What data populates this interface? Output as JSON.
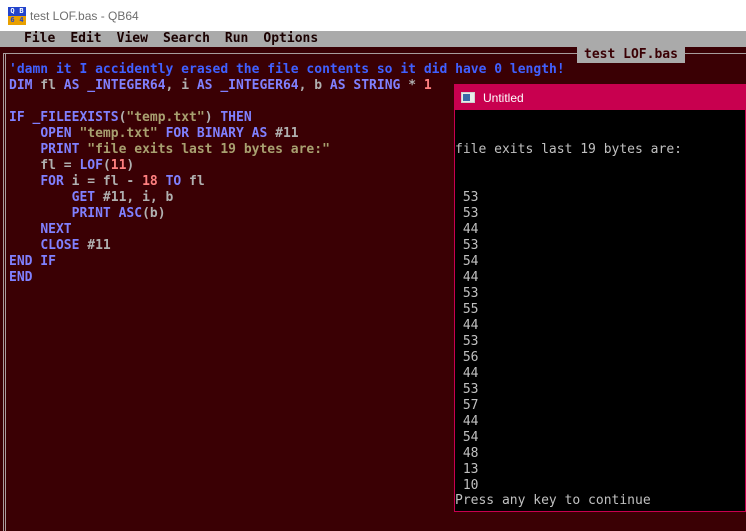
{
  "window": {
    "title": "test LOF.bas - QB64",
    "icon": "qb64-app-icon",
    "icon_text": [
      "Q",
      "B",
      "6",
      "4"
    ]
  },
  "menu": {
    "items": [
      "File",
      "Edit",
      "View",
      "Search",
      "Run",
      "Options"
    ]
  },
  "editor": {
    "file_tab": "test LOF.bas",
    "colors": {
      "background": "#3a0004",
      "keyword": "#8080ff",
      "comment": "#4060ff",
      "string": "#a8a070",
      "number": "#ff8080",
      "text": "#b0b0b0"
    },
    "lines": [
      [
        {
          "t": "cm",
          "v": "'damn it I accidently erased the file contents so it did have 0 length!"
        }
      ],
      [
        {
          "t": "kw",
          "v": "DIM"
        },
        {
          "t": "tx",
          "v": " fl "
        },
        {
          "t": "kw",
          "v": "AS _INTEGER64"
        },
        {
          "t": "tx",
          "v": ", i "
        },
        {
          "t": "kw",
          "v": "AS _INTEGER64"
        },
        {
          "t": "tx",
          "v": ", b "
        },
        {
          "t": "kw",
          "v": "AS STRING"
        },
        {
          "t": "tx",
          "v": " * "
        },
        {
          "t": "nm",
          "v": "1"
        }
      ],
      [],
      [
        {
          "t": "kw",
          "v": "IF _FILEEXISTS"
        },
        {
          "t": "tx",
          "v": "("
        },
        {
          "t": "st",
          "v": "\"temp.txt\""
        },
        {
          "t": "tx",
          "v": ") "
        },
        {
          "t": "kw",
          "v": "THEN"
        }
      ],
      [
        {
          "t": "tx",
          "v": "    "
        },
        {
          "t": "kw",
          "v": "OPEN"
        },
        {
          "t": "tx",
          "v": " "
        },
        {
          "t": "st",
          "v": "\"temp.txt\""
        },
        {
          "t": "tx",
          "v": " "
        },
        {
          "t": "kw",
          "v": "FOR BINARY AS"
        },
        {
          "t": "tx",
          "v": " #11"
        }
      ],
      [
        {
          "t": "tx",
          "v": "    "
        },
        {
          "t": "kw",
          "v": "PRINT"
        },
        {
          "t": "tx",
          "v": " "
        },
        {
          "t": "st",
          "v": "\"file exits last 19 bytes are:\""
        }
      ],
      [
        {
          "t": "tx",
          "v": "    fl = "
        },
        {
          "t": "kw",
          "v": "LOF"
        },
        {
          "t": "tx",
          "v": "("
        },
        {
          "t": "nm",
          "v": "11"
        },
        {
          "t": "tx",
          "v": ")"
        }
      ],
      [
        {
          "t": "tx",
          "v": "    "
        },
        {
          "t": "kw",
          "v": "FOR"
        },
        {
          "t": "tx",
          "v": " i = fl - "
        },
        {
          "t": "nm",
          "v": "18"
        },
        {
          "t": "tx",
          "v": " "
        },
        {
          "t": "kw",
          "v": "TO"
        },
        {
          "t": "tx",
          "v": " fl"
        }
      ],
      [
        {
          "t": "tx",
          "v": "        "
        },
        {
          "t": "kw",
          "v": "GET"
        },
        {
          "t": "tx",
          "v": " #11, i, b"
        }
      ],
      [
        {
          "t": "tx",
          "v": "        "
        },
        {
          "t": "kw",
          "v": "PRINT ASC"
        },
        {
          "t": "tx",
          "v": "(b)"
        }
      ],
      [
        {
          "t": "tx",
          "v": "    "
        },
        {
          "t": "kw",
          "v": "NEXT"
        }
      ],
      [
        {
          "t": "tx",
          "v": "    "
        },
        {
          "t": "kw",
          "v": "CLOSE"
        },
        {
          "t": "tx",
          "v": " #11"
        }
      ],
      [
        {
          "t": "kw",
          "v": "END IF"
        }
      ],
      [
        {
          "t": "kw",
          "v": "END"
        }
      ]
    ]
  },
  "console": {
    "title": "Untitled",
    "icon": "console-window-icon",
    "header_line": "file exits last 19 bytes are:",
    "values": [
      "53",
      "53",
      "44",
      "53",
      "54",
      "44",
      "53",
      "55",
      "44",
      "53",
      "56",
      "44",
      "53",
      "57",
      "44",
      "54",
      "48",
      "13",
      "10"
    ],
    "footer": "Press any key to continue"
  }
}
